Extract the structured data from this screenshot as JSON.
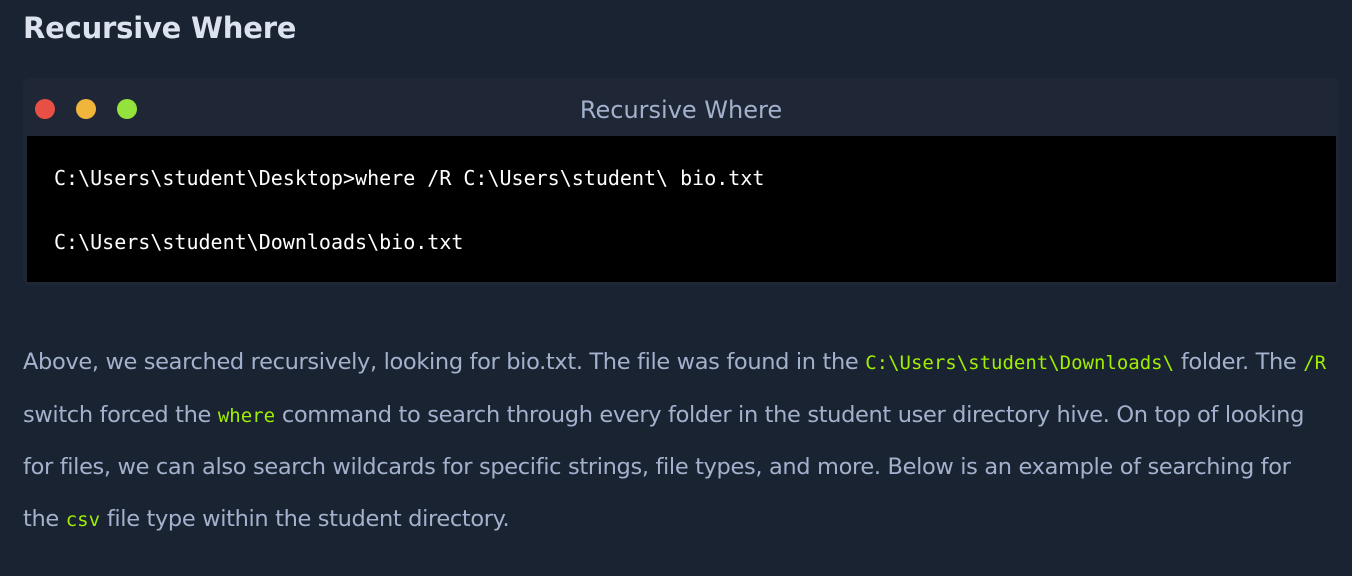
{
  "section": {
    "title": "Recursive Where"
  },
  "terminal": {
    "title": "Recursive Where",
    "lines": [
      "C:\\Users\\student\\Desktop>where /R C:\\Users\\student\\ bio.txt",
      "",
      "C:\\Users\\student\\Downloads\\bio.txt"
    ],
    "window_buttons": [
      "close-dot",
      "minimize-dot",
      "maximize-dot"
    ]
  },
  "paragraph": {
    "t1": "Above, we searched recursively, looking for bio.txt. The file was found in the ",
    "c1": "C:\\Users\\student\\Downloads\\",
    "t2": " folder. The ",
    "c2": "/R",
    "t3": " switch forced the ",
    "c3": "where",
    "t4": " command to search through every folder in the student user directory hive. On top of looking for files, we can also search wildcards for specific strings, file types, and more. Below is an example of searching for the ",
    "c4": "csv",
    "t5": " file type within the student directory."
  },
  "colors": {
    "background": "#1a2332",
    "terminal_frame": "#1f2736",
    "terminal_body": "#000000",
    "code_highlight": "#9fef00",
    "dot_red": "#e84f45",
    "dot_yellow": "#f0b53a",
    "dot_green": "#94e33d"
  }
}
